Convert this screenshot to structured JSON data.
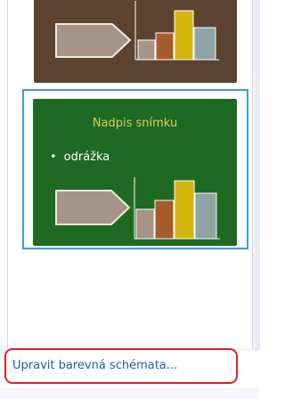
{
  "colors": {
    "scheme_1_background": "#5b4330",
    "scheme_2_background": "#1f6a22",
    "selection_border": "#3d9be9",
    "annotation_outline": "#e0202a",
    "link": "#1b5fae",
    "title_text": "#d8cc5c",
    "shape_fill": "#a79488",
    "bar_1": "#a79488",
    "bar_2": "#a55d2e",
    "bar_3": "#d4b40c",
    "bar_4": "#8fa3a6"
  },
  "thumbnails": [
    {
      "title": "",
      "bullet": "",
      "selected": false
    },
    {
      "title": "Nadpis snímku",
      "bullet": "odrážka",
      "bullet_marker": "•",
      "selected": true
    }
  ],
  "footer": {
    "edit_schemes_label": "Upravit barevná schémata..."
  }
}
